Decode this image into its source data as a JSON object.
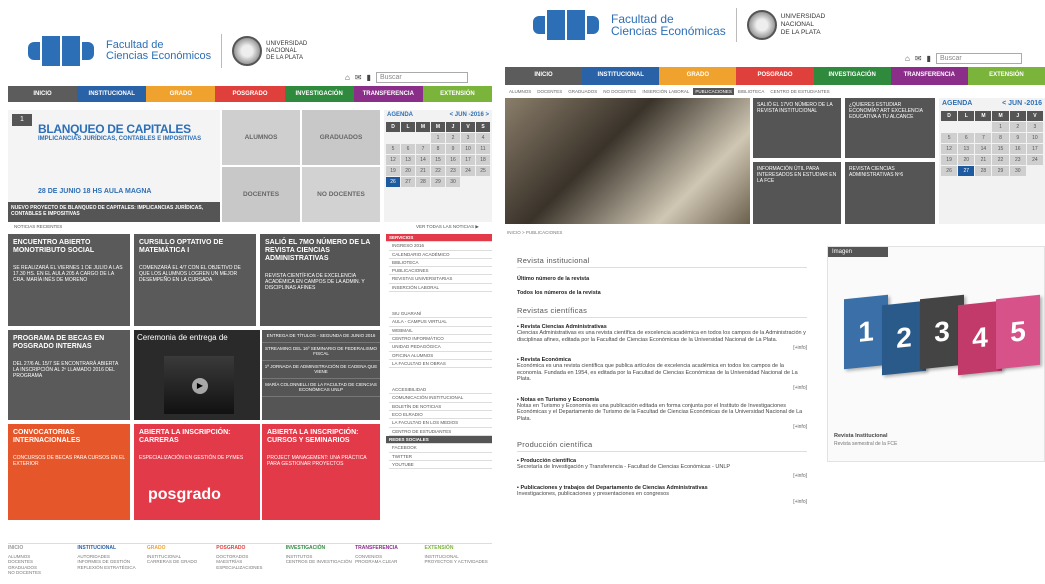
{
  "left": {
    "logo": {
      "faculty_line1": "Facultad de",
      "faculty_line2": "Ciencias Económicos",
      "unlp_line1": "UNIVERSIDAD",
      "unlp_line2": "NACIONAL",
      "unlp_line3": "DE LA PLATA"
    },
    "search_placeholder": "Buscar",
    "nav": [
      {
        "label": "INICIO",
        "color": "#5c5c5c"
      },
      {
        "label": "INSTITUCIONAL",
        "color": "#2a62a8"
      },
      {
        "label": "GRADO",
        "color": "#f0a22e"
      },
      {
        "label": "POSGRADO",
        "color": "#e0403c"
      },
      {
        "label": "INVESTIGACIÓN",
        "color": "#2f8a3e"
      },
      {
        "label": "TRANSFERENCIA",
        "color": "#8a2e8a"
      },
      {
        "label": "EXTENSIÓN",
        "color": "#7bb43a"
      }
    ],
    "banner": {
      "title": "BLANQUEO DE CAPITALES",
      "subtitle": "IMPLICANCIAS JURÍDICAS, CONTABLES E IMPOSITIVAS",
      "date": "28 DE JUNIO 18 HS AULA MAGNA",
      "caption": "NUEVO PROYECTO DE BLANQUEO DE CAPITALES: IMPLICANCIAS JURÍDICAS, CONTABLES E IMPOSITIVAS"
    },
    "quick": {
      "alumnos": "ALUMNOS",
      "graduados": "GRADUADOS",
      "docentes": "DOCENTES",
      "no_docentes": "NO DOCENTES"
    },
    "calendar": {
      "title": "AGENDA",
      "month": "< JUN -2016 >",
      "headers": [
        "D",
        "L",
        "M",
        "M",
        "J",
        "V",
        "S"
      ],
      "days": [
        "",
        "",
        "",
        "1",
        "2",
        "3",
        "4",
        "5",
        "6",
        "7",
        "8",
        "9",
        "10",
        "11",
        "12",
        "13",
        "14",
        "15",
        "16",
        "17",
        "18",
        "19",
        "20",
        "21",
        "22",
        "23",
        "24",
        "25",
        "26",
        "27",
        "28",
        "29",
        "30",
        "",
        ""
      ]
    },
    "noticias_label": "NOTICIAS RECIENTES",
    "ver_todas": "VER TODAS LAS NOTICIAS ▶",
    "tiles": [
      {
        "title": "ENCUENTRO ABIERTO MONOTRIBUTO SOCIAL",
        "text": "SE REALIZARÁ EL VIERNES 1 DE JULIO A LAS 17.30 HS. EN EL AULA 205 A CARGO DE LA CRA. MARÍA INÉS DE MORENO"
      },
      {
        "title": "CURSILLO OPTATIVO DE MATEMÁTICA I",
        "text": "COMENZARÁ EL 4/7 CON EL OBJETIVO DE QUE LOS ALUMNOS LOGREN UN MEJOR DESEMPEÑO EN LA CURSADA"
      },
      {
        "title": "SALIÓ EL 7MO NÚMERO DE LA REVISTA CIENCIAS ADMINISTRATIVAS",
        "text": "REVISTA CIENTÍFICA DE EXCELENCIA ACADÉMICA EN CAMPOS DE LA ADMIN. Y DISCIPLINAS AFINES"
      },
      {
        "title": "PROGRAMA DE BECAS EN POSGRADO INTERNAS",
        "text": "DEL 27/6 AL 15/7 SE ENCONTRARÁ ABIERTA LA INSCRIPCIÓN AL 2º LLAMADO 2016 DEL PROGRAMA"
      },
      {
        "title": "CONVOCATORIAS INTERNACIONALES",
        "text": "CONCURSOS DE BECAS PARA CURSOS EN EL EXTERIOR"
      },
      {
        "title": "ABIERTA LA INSCRIPCIÓN: CARRERAS",
        "text": "ESPECIALIZACIÓN EN GESTIÓN DE PYMES"
      },
      {
        "title": "ABIERTA LA INSCRIPCIÓN: CURSOS Y SEMINARIOS",
        "text": "PROJECT MANAGEMENT: UNA PRÁCTICA PARA GESTIONAR PROYECTOS"
      }
    ],
    "video_title": "Ceremonia de entrega de",
    "posgrado_label": "posgrado",
    "news_list": [
      "ENTREGA DE TÍTULOS - SEGUNDA DE JUNIO 2016",
      "STREAMING DEL 16º SEMINARIO DE FEDERALISMO FISCAL",
      "1ª JORNADA DE ADMINISTRACIÓN DE CADENA QUE VIENE",
      "MARÍA COLONNELLI DE LA FACULTAD DE CIENCIAS ECONÓMICAS UNLP"
    ],
    "side_header1": "SERVICIOS",
    "side_list1": [
      "INGRESO 2016",
      "CALENDARIO ACADÉMICO",
      "BIBLIOTECA",
      "PUBLICACIONES",
      "REVISTAS UNIVERSITARIAS",
      "INSERCIÓN LABORAL"
    ],
    "side_list2": [
      "SIU GUARANÍ",
      "AULA - CAMPUS VIRTUAL",
      "WEBMAIL",
      "CENTRO INFORMÁTICO",
      "UNIDAD PEDAGÓGICA",
      "OFICINA ALUMNOS",
      "LA FACULTAD EN OBRAS"
    ],
    "side_list3": [
      "ACCESIBILIDAD",
      "COMUNICACIÓN INSTITUCIONAL",
      "BOLETÍN DE NOTICIAS",
      "ECO ELRADIO",
      "LA FACULTAD EN LOS MEDIOS",
      "CENTRO DE ESTUDIANTES"
    ],
    "side_header2": "REDES SOCIALES",
    "side_list4": [
      "FACEBOOK",
      "TWITTER",
      "YOUTUBE"
    ],
    "footer": [
      {
        "head": "INICIO",
        "items": [
          "ALUMNOS",
          "DOCENTES",
          "GRADUADOS",
          "NO DOCENTES"
        ]
      },
      {
        "head": "INSTITUCIONAL",
        "items": [
          "AUTORIDADES",
          "INFORMES DE GESTIÓN",
          "REFLEXIÓN ESTRATÉGICA"
        ]
      },
      {
        "head": "GRADO",
        "items": [
          "INSTITUCIONAL",
          "CARRERAS DE GRADO"
        ]
      },
      {
        "head": "POSGRADO",
        "items": [
          "DOCTORADOS",
          "MAESTRÍAS",
          "ESPECIALIZACIONES"
        ]
      },
      {
        "head": "INVESTIGACIÓN",
        "items": [
          "INSTITUTOS",
          "CENTROS DE INVESTIGACIÓN"
        ]
      },
      {
        "head": "TRANSFERENCIA",
        "items": [
          "CONVENIOS",
          "PROGRAMA CLEAR"
        ]
      },
      {
        "head": "EXTENSIÓN",
        "items": [
          "INSTITUCIONAL",
          "PROYECTOS Y ACTIVIDADES"
        ]
      }
    ]
  },
  "right": {
    "logo": {
      "faculty_line1": "Facultad de",
      "faculty_line2": "Ciencias Económicas",
      "unlp_line1": "UNIVERSIDAD",
      "unlp_line2": "NACIONAL",
      "unlp_line3": "DE LA PLATA"
    },
    "search_placeholder": "Buscar",
    "nav": [
      {
        "label": "INICIO",
        "color": "#5c5c5c"
      },
      {
        "label": "INSTITUCIONAL",
        "color": "#2a62a8"
      },
      {
        "label": "GRADO",
        "color": "#f0a22e"
      },
      {
        "label": "POSGRADO",
        "color": "#e0403c"
      },
      {
        "label": "INVESTIGACIÓN",
        "color": "#2f8a3e"
      },
      {
        "label": "TRANSFERENCIA",
        "color": "#8a2e8a"
      },
      {
        "label": "EXTENSIÓN",
        "color": "#7bb43a"
      }
    ],
    "subnav": [
      "ALUMNOS",
      "DOCENTES",
      "GRADUADOS",
      "NO DOCENTES",
      "INSERCIÓN LABORAL",
      "PUBLICACIONES",
      "BIBLIOTECA",
      "CENTRO DE ESTUDIANTES"
    ],
    "promo": [
      "SALIÓ EL 17VO NÚMERO DE LA REVISTA INSTITUCIONAL",
      "¿QUIERES ESTUDIAR ECONOMÍA? ART EXCELENCIA EDUCATIVA A TU ALCANCE",
      "INFORMACIÓN ÚTIL PARA INTERESADOS EN ESTUDIAR EN LA FCE",
      "REVISTA CIENCIAS ADMINISTRATIVAS Nº6"
    ],
    "calendar": {
      "title": "AGENDA",
      "month": "< JUN -2016",
      "headers": [
        "D",
        "L",
        "M",
        "M",
        "J",
        "V"
      ],
      "days": [
        "",
        "",
        "",
        "1",
        "2",
        "3",
        "5",
        "6",
        "7",
        "8",
        "9",
        "10",
        "12",
        "13",
        "14",
        "15",
        "16",
        "17",
        "19",
        "20",
        "21",
        "22",
        "23",
        "24",
        "26",
        "27",
        "28",
        "29",
        "30",
        ""
      ]
    },
    "breadcrumb": "INICIO > PUBLICACIONES",
    "sec_institucional": "Revista institucional",
    "inst_items": [
      "Último número de la revista",
      "Todos los números de la revista"
    ],
    "sec_cientificas": "Revistas científicas",
    "revistas": [
      {
        "title": "Revista Ciencias Administrativas",
        "text": "Ciencias Administrativas es una revista científica de excelencia académica en todos los campos de la Administración y disciplinas afines, editada por la Facultad de Ciencias Económicas de la Universidad Nacional de La Plata.",
        "more": "[+info]"
      },
      {
        "title": "Revista Económica",
        "text": "Económica es una revista científica que publica artículos de excelencia académica en todos los campos de la economía. Fundada en 1954, es editada por la Facultad de Ciencias Económicas de la Universidad Nacional de La Plata.",
        "more": "[+info]"
      },
      {
        "title": "Notas en Turismo y Economía",
        "text": "Notas en Turismo y Economía es una publicación editada en forma conjunta por el Instituto de Investigaciones Económicas y el Departamento de Turismo de la Facultad de Ciencias Económicas de la Universidad Nacional de La Plata.",
        "more": "[+info]"
      }
    ],
    "sec_produccion": "Producción científica",
    "produccion": [
      {
        "title": "Producción científica",
        "text": "Secretaría de Investigación y Transferencia - Facultad de Ciencias Económicas - UNLP",
        "more": "[+info]"
      },
      {
        "title": "Publicaciones y trabajos del Departamento de Ciencias Administrativas",
        "text": "Investigaciones, publicaciones y presentaciones en congresos",
        "more": "[+info]"
      }
    ],
    "imagen_label": "Imagen",
    "imagen_caption_title": "Revista Institucional",
    "imagen_caption_sub": "Revista semestral de la FCE",
    "book_numbers": [
      "1",
      "2",
      "3",
      "4",
      "5"
    ]
  }
}
